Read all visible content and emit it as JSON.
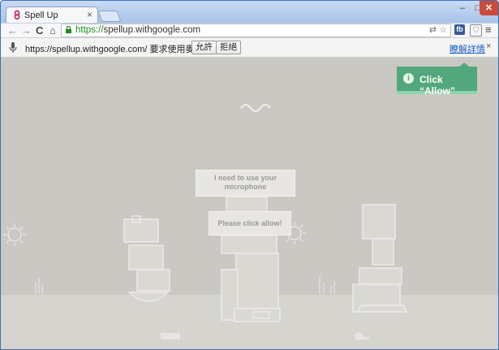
{
  "browser": {
    "tab_title": "Spell Up",
    "tab_close": "×",
    "url_scheme": "https://",
    "url_host": "spellup.withgoogle.com",
    "window_controls": {
      "minimize": "–",
      "maximize": "□",
      "close": "✕"
    },
    "extension_fb_label": "fb",
    "menu_glyph": "≡"
  },
  "nav": {
    "back": "←",
    "forward": "→",
    "reload": "C",
    "home": "⌂"
  },
  "infobar": {
    "message": "https://spellup.withgoogle.com/ 要求使用麥克風。",
    "allow_label": "允許",
    "deny_label": "拒絕",
    "learn_more_label": "瞭解詳情",
    "close_glyph": "×"
  },
  "page": {
    "sign_top": "I need to use your microphone",
    "sign_bottom": "Please click allow!",
    "callout_label": "Click “Allow”",
    "callout_icon": "i"
  },
  "colors": {
    "accent_green": "#52a87c",
    "content_bg": "#cac8c2",
    "ground": "#d6d4ce"
  }
}
